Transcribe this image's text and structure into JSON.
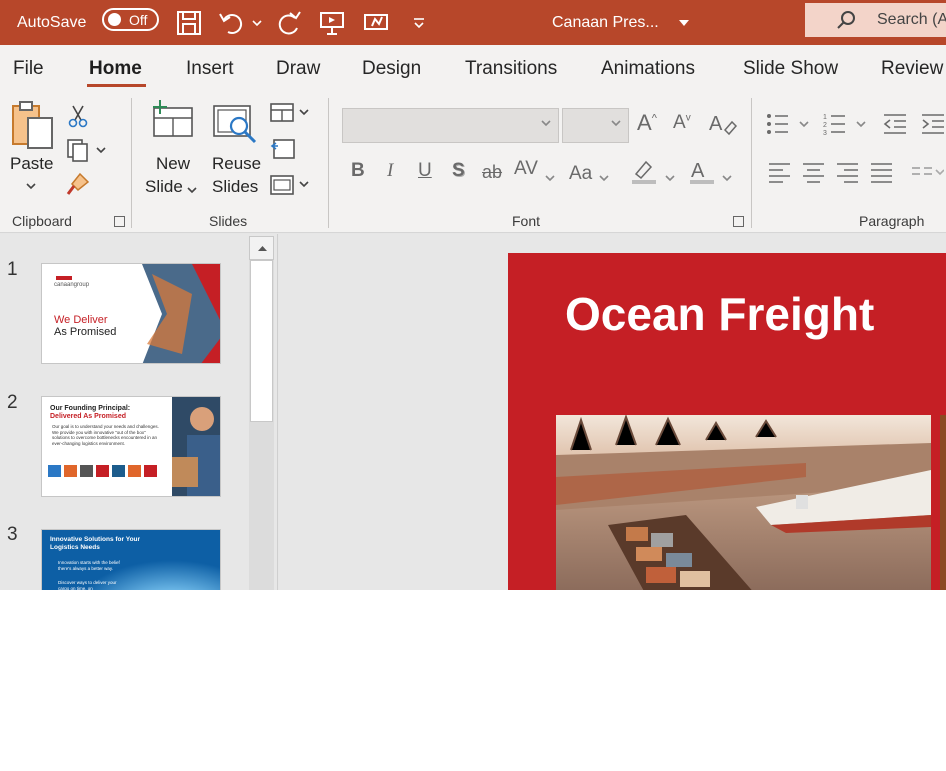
{
  "titlebar": {
    "autosave_label": "AutoSave",
    "toggle_state": "Off",
    "doc_title": "Canaan Pres...",
    "search_label": "Search (A"
  },
  "tabs": [
    {
      "label": "File"
    },
    {
      "label": "Home",
      "active": true
    },
    {
      "label": "Insert"
    },
    {
      "label": "Draw"
    },
    {
      "label": "Design"
    },
    {
      "label": "Transitions"
    },
    {
      "label": "Animations"
    },
    {
      "label": "Slide Show"
    },
    {
      "label": "Review"
    }
  ],
  "ribbon": {
    "clipboard": {
      "paste_label": "Paste",
      "group_label": "Clipboard"
    },
    "slides": {
      "new_slide_line1": "New",
      "new_slide_line2": "Slide",
      "reuse_line1": "Reuse",
      "reuse_line2": "Slides",
      "group_label": "Slides"
    },
    "font": {
      "font_name": "",
      "font_size": "",
      "group_label": "Font",
      "bold": "B",
      "italic": "I",
      "underline": "U",
      "shadow": "S",
      "strike": "ab",
      "spacing": "AV",
      "case": "Aa",
      "grow": "A",
      "shrink": "A",
      "font_color": "A"
    },
    "paragraph": {
      "group_label": "Paragraph"
    }
  },
  "thumbnails": [
    {
      "number": "1",
      "brand": "canaangroup",
      "line1": "We Deliver",
      "line2": "As Promised"
    },
    {
      "number": "2",
      "title_line1": "Our Founding Principal:",
      "title_line2": "Delivered As Promised",
      "body": "Our goal is to understand your needs and challenges. We provide you with innovative \"out of the box\" solutions to overcome bottlenecks encountered in an ever-changing logistics environment."
    },
    {
      "number": "3",
      "title": "Innovative Solutions for Your Logistics Needs",
      "bullet1": "Innovation starts with the belief there's always a better way.",
      "bullet2": "Discover ways to deliver your cargo on time, on"
    }
  ],
  "slide": {
    "title": "Ocean Freight"
  },
  "colors": {
    "accent": "#b7472a",
    "slide_red": "#c51f25"
  }
}
